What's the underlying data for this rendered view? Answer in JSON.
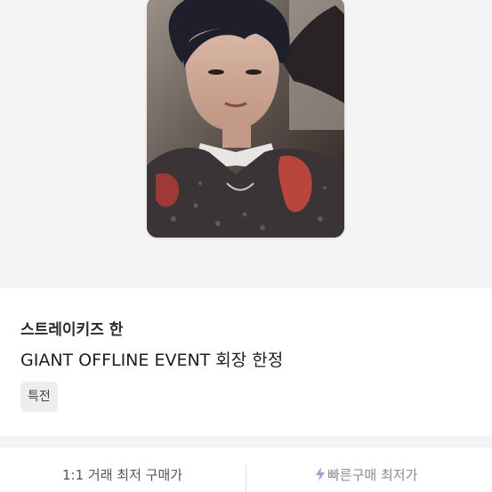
{
  "product": {
    "artist": "스트레이키즈 한",
    "title": "GIANT OFFLINE EVENT 회장 한정",
    "tag": "특전",
    "image_alt": "photocard-image"
  },
  "price_bar": {
    "left_label": "1:1 거래 최저 구매가",
    "right_label": "빠른구매 최저가",
    "right_icon": "lightning-bolt-icon"
  },
  "colors": {
    "background_gray": "#f4f4f4",
    "tag_bg": "#ededed",
    "bolt_purple": "#a79be8"
  }
}
